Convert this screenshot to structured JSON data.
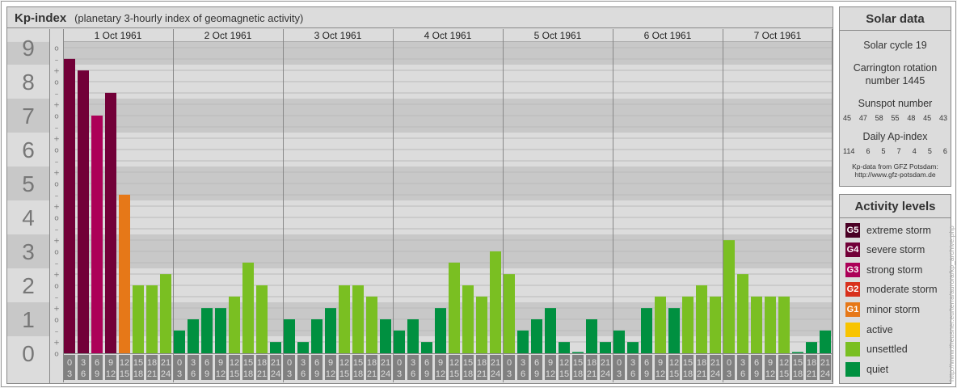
{
  "header": {
    "title": "Kp-index",
    "subtitle": "(planetary 3-hourly index of geomagnetic activity)"
  },
  "chart_data": {
    "type": "bar",
    "title": "Kp-index",
    "subtitle": "(planetary 3-hourly index of geomagnetic activity)",
    "ylabel": "Kp",
    "ylim": [
      0,
      9
    ],
    "y_ticks": [
      "0",
      "1",
      "2",
      "3",
      "4",
      "5",
      "6",
      "7",
      "8",
      "9"
    ],
    "third_markers": {
      "minus": "–",
      "zero": "o",
      "plus": "+"
    },
    "days": [
      "1 Oct 1961",
      "2 Oct 1961",
      "3 Oct 1961",
      "4 Oct 1961",
      "5 Oct 1961",
      "6 Oct 1961",
      "7 Oct 1961"
    ],
    "hour_ranges": [
      [
        "0",
        "3"
      ],
      [
        "3",
        "6"
      ],
      [
        "6",
        "9"
      ],
      [
        "9",
        "12"
      ],
      [
        "12",
        "15"
      ],
      [
        "15",
        "18"
      ],
      [
        "18",
        "21"
      ],
      [
        "21",
        "24"
      ]
    ],
    "series": [
      {
        "name": "1 Oct 1961",
        "values": [
          8.67,
          8.33,
          7,
          7.67,
          4.67,
          2,
          2,
          2.33
        ]
      },
      {
        "name": "2 Oct 1961",
        "values": [
          0.67,
          1,
          1.33,
          1.33,
          1.67,
          2.67,
          2,
          0.33
        ]
      },
      {
        "name": "3 Oct 1961",
        "values": [
          1,
          0.33,
          1,
          1.33,
          2,
          2,
          1.67,
          1
        ]
      },
      {
        "name": "4 Oct 1961",
        "values": [
          0.67,
          1,
          0.33,
          1.33,
          2.67,
          2,
          1.67,
          3
        ]
      },
      {
        "name": "5 Oct 1961",
        "values": [
          2.33,
          0.67,
          1,
          1.33,
          0.33,
          0,
          1,
          0.33
        ]
      },
      {
        "name": "6 Oct 1961",
        "values": [
          0.67,
          0.33,
          1.33,
          1.67,
          1.33,
          1.67,
          2,
          1.67
        ]
      },
      {
        "name": "7 Oct 1961",
        "values": [
          3.33,
          2.33,
          1.67,
          1.67,
          1.67,
          0,
          0.33,
          0.67
        ]
      }
    ]
  },
  "solar": {
    "title": "Solar data",
    "cycle": "Solar cycle 19",
    "carrington": "Carrington rotation number 1445",
    "sunspot_label": "Sunspot number",
    "sunspots": [
      "45",
      "47",
      "58",
      "55",
      "48",
      "45",
      "43"
    ],
    "ap_label": "Daily Ap-index",
    "ap": [
      "114",
      "6",
      "5",
      "7",
      "4",
      "5",
      "6"
    ],
    "source1": "Kp-data from GFZ Potsdam:",
    "source2": "http://www.gfz-potsdam.de"
  },
  "levels": {
    "title": "Activity levels",
    "items": [
      {
        "badge": "G5",
        "label": "extreme storm",
        "color": "#4a0024"
      },
      {
        "badge": "G4",
        "label": "severe storm",
        "color": "#720038"
      },
      {
        "badge": "G3",
        "label": "strong storm",
        "color": "#ac0058"
      },
      {
        "badge": "G2",
        "label": "moderate storm",
        "color": "#d8301c"
      },
      {
        "badge": "G1",
        "label": "minor storm",
        "color": "#e67818"
      },
      {
        "badge": "",
        "label": "active",
        "color": "#f8c400"
      },
      {
        "badge": "",
        "label": "unsettled",
        "color": "#7abf22"
      },
      {
        "badge": "",
        "label": "quiet",
        "color": "#009040"
      }
    ]
  },
  "watermark": "http://www.theusner.eu/terra/aurora/kp_archive.php"
}
